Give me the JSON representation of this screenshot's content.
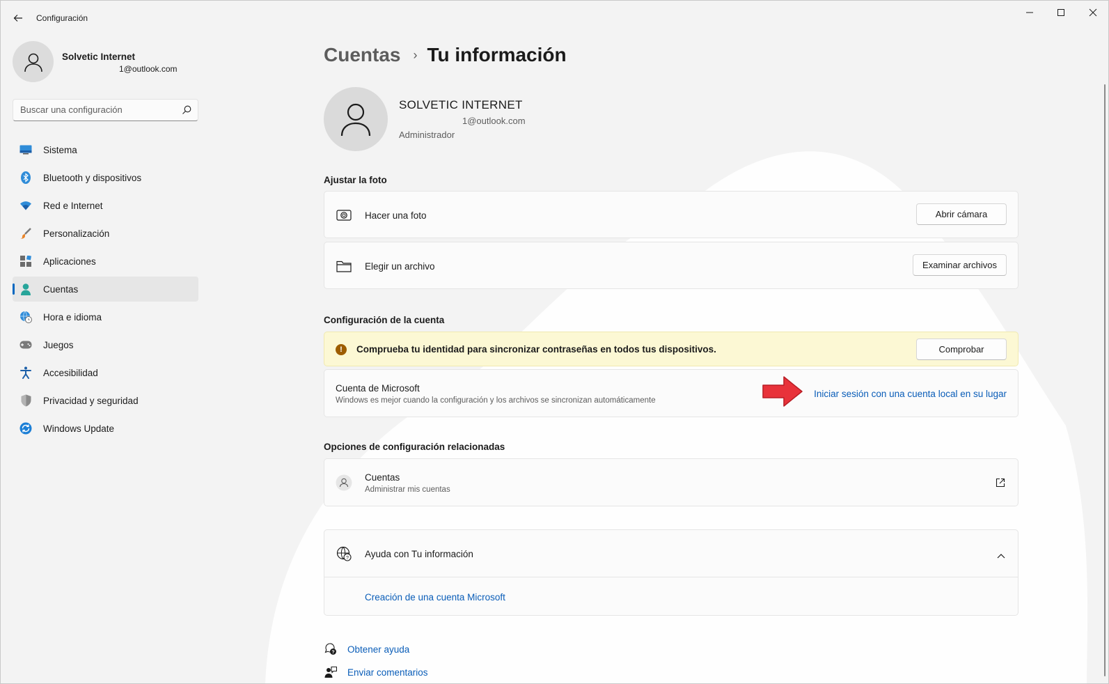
{
  "window": {
    "title": "Configuración",
    "controls": {
      "minimize": "minimize-icon",
      "maximize": "maximize-icon",
      "close": "close-icon"
    }
  },
  "profile": {
    "name": "Solvetic Internet",
    "email": "1@outlook.com"
  },
  "search": {
    "placeholder": "Buscar una configuración"
  },
  "sidebar": {
    "items": [
      {
        "label": "Sistema",
        "icon": "monitor-icon"
      },
      {
        "label": "Bluetooth y dispositivos",
        "icon": "bluetooth-icon"
      },
      {
        "label": "Red e Internet",
        "icon": "wifi-icon"
      },
      {
        "label": "Personalización",
        "icon": "brush-icon"
      },
      {
        "label": "Aplicaciones",
        "icon": "apps-icon"
      },
      {
        "label": "Cuentas",
        "icon": "person-icon",
        "active": true
      },
      {
        "label": "Hora e idioma",
        "icon": "globe-clock-icon"
      },
      {
        "label": "Juegos",
        "icon": "gamepad-icon"
      },
      {
        "label": "Accesibilidad",
        "icon": "accessibility-icon"
      },
      {
        "label": "Privacidad y seguridad",
        "icon": "shield-icon"
      },
      {
        "label": "Windows Update",
        "icon": "update-icon"
      }
    ]
  },
  "breadcrumb": {
    "parent": "Cuentas",
    "separator": "›",
    "current": "Tu información"
  },
  "user": {
    "name": "SOLVETIC INTERNET",
    "email": "1@outlook.com",
    "role": "Administrador"
  },
  "photo_section": {
    "title": "Ajustar la foto",
    "take_photo": {
      "label": "Hacer una foto",
      "button": "Abrir cámara",
      "icon": "camera-icon"
    },
    "choose_file": {
      "label": "Elegir un archivo",
      "button": "Examinar archivos",
      "icon": "folder-icon"
    }
  },
  "account_section": {
    "title": "Configuración de la cuenta",
    "warning": {
      "text": "Comprueba tu identidad para sincronizar contraseñas en todos tus dispositivos.",
      "button": "Comprobar",
      "icon": "warning-icon",
      "color": "#9d5d00"
    },
    "microsoft_account": {
      "label": "Cuenta de Microsoft",
      "description": "Windows es mejor cuando la configuración y los archivos se sincronizan automáticamente",
      "link": "Iniciar sesión con una cuenta local en su lugar"
    }
  },
  "related_section": {
    "title": "Opciones de configuración relacionadas",
    "accounts": {
      "label": "Cuentas",
      "description": "Administrar mis cuentas",
      "icon": "person-circle-icon",
      "action_icon": "external-link-icon"
    }
  },
  "help_section": {
    "label": "Ayuda con Tu información",
    "icon": "globe-help-icon",
    "link": "Creación de una cuenta Microsoft"
  },
  "footer": {
    "get_help": "Obtener ayuda",
    "feedback": "Enviar comentarios"
  },
  "colors": {
    "accent": "#0067c0",
    "link": "#0a5db8",
    "arrow": "#e8323a",
    "warning_bg": "#fcf8d4"
  }
}
